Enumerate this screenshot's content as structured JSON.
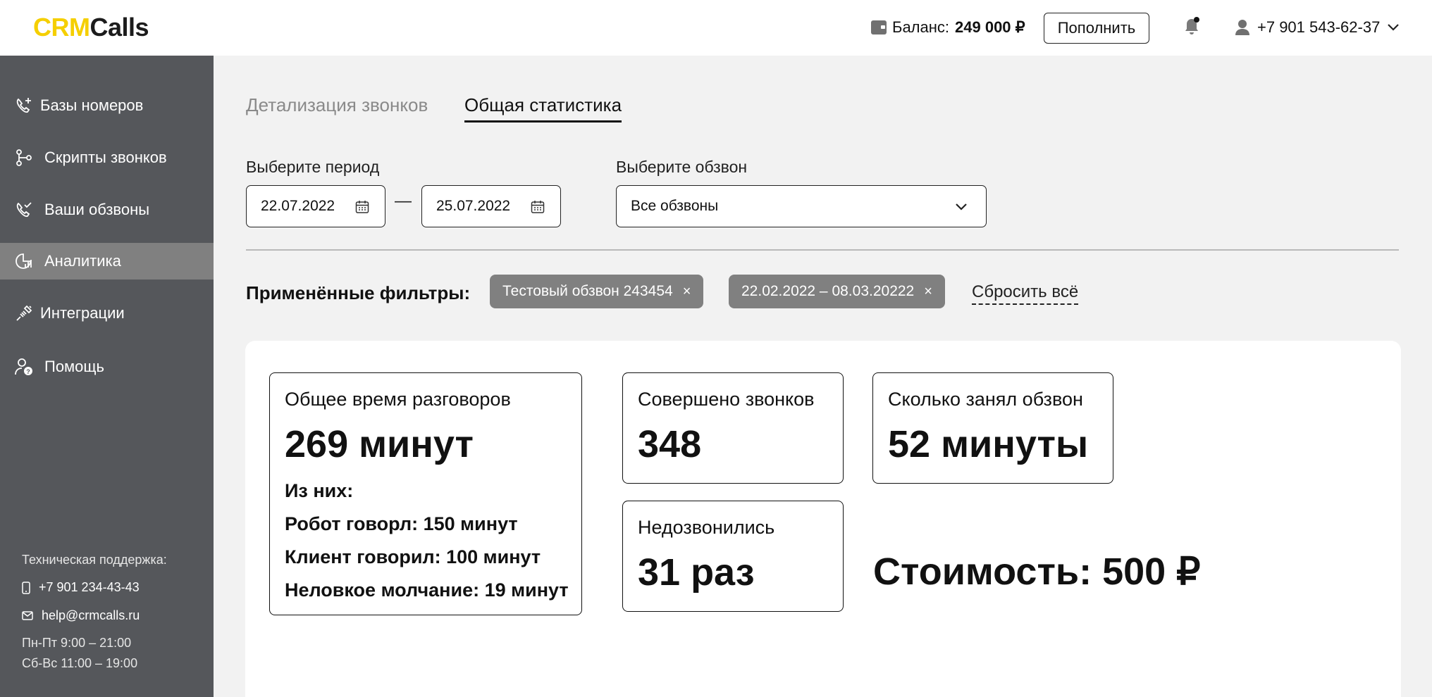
{
  "header": {
    "logo_part1": "CRM",
    "logo_part2": "Calls",
    "balance_label": "Баланс:",
    "balance_value": "249 000 ₽",
    "topup_label": "Пополнить",
    "user_phone": "+7 901 543-62-37",
    "icons": {
      "wallet": "wallet-icon",
      "bell": "bell-icon",
      "user": "user-icon",
      "chevron": "chevron-down-icon"
    }
  },
  "sidebar": {
    "items": [
      {
        "label": "Базы номеров",
        "icon": "phone-plus-icon"
      },
      {
        "label": "Скрипты звонков",
        "icon": "script-branch-icon"
      },
      {
        "label": "Ваши обзвоны",
        "icon": "phone-check-icon"
      },
      {
        "label": "Аналитика",
        "icon": "analytics-icon",
        "active": true
      },
      {
        "label": "Интеграции",
        "icon": "integration-plug-icon"
      },
      {
        "label": "Помощь",
        "icon": "help-user-icon"
      }
    ],
    "support": {
      "title": "Техническая поддержка:",
      "phone": "+7 901 234-43-43",
      "email": "help@crmcalls.ru",
      "hours_weekdays": "Пн-Пт 9:00 – 21:00",
      "hours_weekend": "Сб-Вс 11:00 – 19:00"
    }
  },
  "tabs": {
    "details": "Детализация звонков",
    "stats": "Общая статистика"
  },
  "filters": {
    "period_label": "Выберите период",
    "date_from": "22.07.2022",
    "date_to": "25.07.2022",
    "dash": "—",
    "campaign_label": "Выберите обзвон",
    "campaign_value": "Все обзвоны",
    "applied_label": "Применённые фильтры:",
    "chips": [
      "Тестовый обзвон 243454",
      "22.02.2022 – 08.03.20222"
    ],
    "chip_close": "×",
    "reset_label": "Сбросить всё"
  },
  "stats": {
    "total_time_title": "Общее время разговоров",
    "total_time_value": "269 минут",
    "breakdown_title": "Из них:",
    "robot_line": "Робот говорл: 150 минут",
    "client_line": "Клиент говорил: 100 минут",
    "silence_line": "Неловкое молчание: 19 минут",
    "calls_title": "Совершено звонков",
    "calls_value": "348",
    "duration_title": "Сколько занял обзвон",
    "duration_value": "52 минуты",
    "missed_title": "Недозвонились",
    "missed_value": "31 раз",
    "cost": "Стоимость: 500 ₽"
  },
  "colors": {
    "brand_yellow": "#f5cf00",
    "sidebar_bg": "#55575b",
    "sidebar_active": "#808080",
    "chip_bg": "#808080",
    "page_bg": "#f2f2f2"
  }
}
